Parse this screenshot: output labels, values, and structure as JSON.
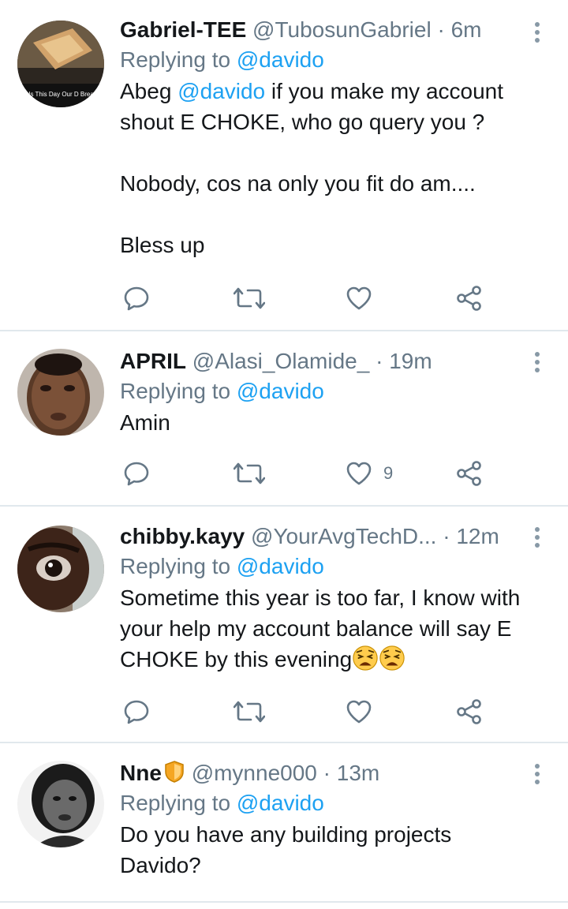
{
  "tweets": [
    {
      "name": "Gabriel-TEE",
      "handle": "@TubosunGabriel",
      "dot": "·",
      "time": "6m",
      "replying_prefix": "Replying to",
      "replying_to": "@davido",
      "avatar_caption": "e Us This Day Our D Bread!?",
      "body_parts": {
        "line1_pre": "Abeg",
        "line1_mention": "@davido",
        "line1_post": "if you make my account shout E CHOKE, who go query you ?",
        "line2": "Nobody, cos na only you fit do am....",
        "line3": "Bless up"
      },
      "like_count": ""
    },
    {
      "name": "APRIL",
      "handle": "@Alasi_Olamide_",
      "dot": "·",
      "time": "19m",
      "replying_prefix": "Replying to",
      "replying_to": "@davido",
      "body": "Amin",
      "like_count": "9"
    },
    {
      "name": "chibby.kayy",
      "handle": "@YourAvgTechD...",
      "dot": "·",
      "time": "12m",
      "replying_prefix": "Replying to",
      "replying_to": "@davido",
      "body": "Sometime this year is too far, I know with your help my account balance will say E CHOKE by this evening",
      "like_count": ""
    },
    {
      "name": "Nne",
      "handle": "@mynne000",
      "dot": "·",
      "time": "13m",
      "replying_prefix": "Replying to",
      "replying_to": "@davido",
      "body": "Do you have any building projects Davido?",
      "like_count": ""
    }
  ],
  "colors": {
    "text": "#14171a",
    "secondary": "#657786",
    "accent": "#1da1f2",
    "divider": "#e1e8ed",
    "icon": "#657786"
  },
  "icons": [
    "reply-icon",
    "retweet-icon",
    "like-icon",
    "share-icon",
    "more-options-icon",
    "shield-badge-icon",
    "weary-face-emoji"
  ]
}
